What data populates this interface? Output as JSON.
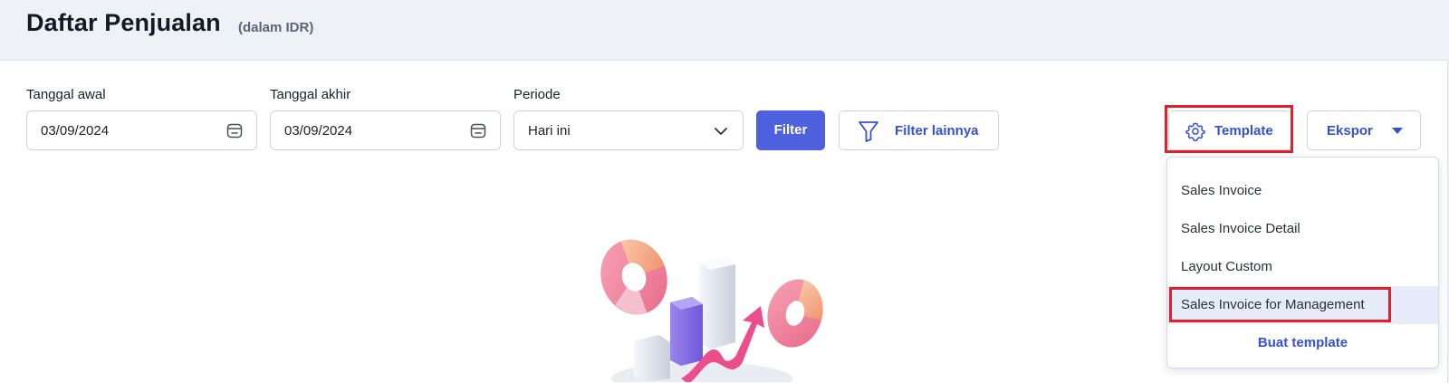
{
  "header": {
    "title": "Daftar Penjualan",
    "subtitle": "(dalam IDR)"
  },
  "filters": {
    "start_date": {
      "label": "Tanggal awal",
      "value": "03/09/2024",
      "icon": "calendar-icon"
    },
    "end_date": {
      "label": "Tanggal akhir",
      "value": "03/09/2024",
      "icon": "calendar-icon"
    },
    "period": {
      "label": "Periode",
      "value": "Hari ini",
      "icon": "chevron-down-icon"
    },
    "filter_button": "Filter",
    "more_filter_button": {
      "label": "Filter lainnya",
      "icon": "funnel-icon"
    }
  },
  "actions": {
    "template_button": {
      "label": "Template",
      "icon": "gear-icon"
    },
    "export_button": {
      "label": "Ekspor",
      "icon": "caret-down-icon"
    }
  },
  "template_menu": {
    "items": [
      {
        "label": "Sales Invoice",
        "active": false
      },
      {
        "label": "Sales Invoice Detail",
        "active": false
      },
      {
        "label": "Layout Custom",
        "active": false
      },
      {
        "label": "Sales Invoice for Management",
        "active": true
      }
    ],
    "create_label": "Buat template"
  },
  "colors": {
    "primary": "#4d61df",
    "link": "#3550d8",
    "highlight": "#e0202b",
    "header_bg": "#eef1f6",
    "menu_active_bg": "#e6ecf9"
  }
}
